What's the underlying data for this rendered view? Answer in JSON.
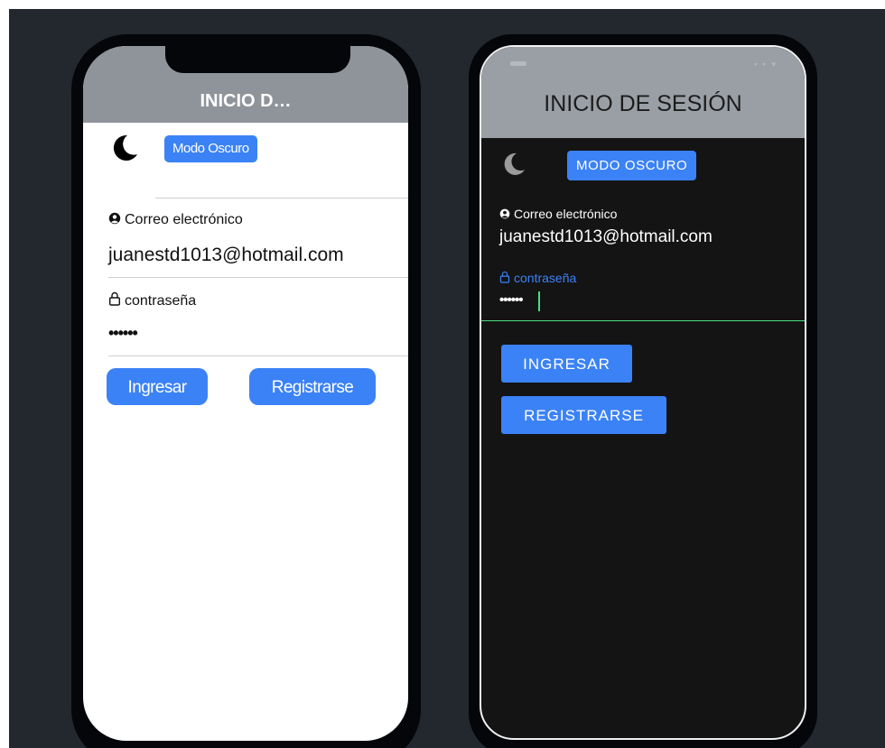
{
  "light_screen": {
    "title": "INICIO D…",
    "mode_button": "Modo Oscuro",
    "email_label": "Correo electrónico",
    "email_value": "juanestd1013@hotmail.com",
    "password_label": "contraseña",
    "password_value": "••••••",
    "login_button": "Ingresar",
    "register_button": "Registrarse",
    "icons": [
      "moon-icon",
      "user-circle-icon",
      "lock-icon"
    ]
  },
  "dark_screen": {
    "title": "INICIO DE SESIÓN",
    "mode_button": "MODO OSCURO",
    "email_label": "Correo electrónico",
    "email_value": "juanestd1013@hotmail.com",
    "password_label": "contraseña",
    "password_value": "••••••",
    "login_button": "INGRESAR",
    "register_button": "REGISTRARSE",
    "status_icons": "▪ ▪ ▾",
    "icons": [
      "moon-icon",
      "user-circle-icon",
      "lock-icon"
    ]
  },
  "colors": {
    "background": "#23272e",
    "accent": "#3b82f6",
    "header_gray": "#8f949b",
    "focus_green": "#4ade80",
    "dark_screen_bg": "#141414"
  }
}
